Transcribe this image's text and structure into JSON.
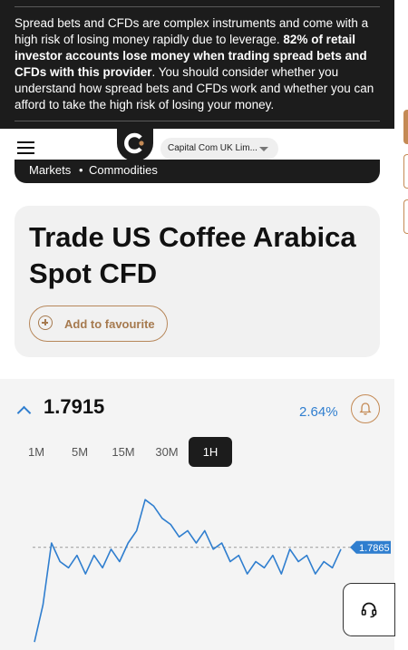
{
  "risk_warning": {
    "part1": "Spread bets and CFDs are complex instruments and come with a high risk of losing money rapidly due to leverage. ",
    "bold": "82% of retail investor accounts lose money when trading spread bets and CFDs with this provider",
    "part2": ". You should consider whether you understand how spread bets and CFDs work and whether you can afford to take the high risk of losing your money."
  },
  "header": {
    "entity_selector": "Capital Com UK Lim..."
  },
  "breadcrumb": {
    "items": [
      "Markets",
      "Commodities"
    ],
    "separator": "•"
  },
  "instrument": {
    "title": "Trade US Coffee Arabica Spot CFD",
    "favourite_label": "Add to favourite"
  },
  "quote": {
    "price": "1.7915",
    "change": "2.64%",
    "direction": "up",
    "timeframes": [
      "1M",
      "5M",
      "15M",
      "30M",
      "1H"
    ],
    "active_timeframe": "1H"
  },
  "chart_data": {
    "type": "line",
    "title": "",
    "xlabel": "",
    "ylabel": "",
    "current_value_label": "1.7865",
    "reference_line": 1.7865,
    "ylim": [
      1.705,
      1.8325
    ],
    "series": [
      {
        "values": [
          1.71,
          1.74,
          1.79,
          1.775,
          1.77,
          1.78,
          1.765,
          1.78,
          1.77,
          1.785,
          1.775,
          1.79,
          1.8,
          1.825,
          1.82,
          1.81,
          1.805,
          1.795,
          1.8,
          1.79,
          1.8,
          1.785,
          1.79,
          1.775,
          1.78,
          1.765,
          1.775,
          1.77,
          1.78,
          1.765,
          1.785,
          1.775,
          1.78,
          1.765,
          1.775,
          1.77,
          1.785
        ]
      }
    ]
  },
  "colors": {
    "accent": "#2f7ecf",
    "brand_gold": "#c48a55",
    "dark": "#1c1c1c"
  },
  "icons": {
    "menu": "hamburger-icon",
    "bell": "bell-icon",
    "support": "headset-icon",
    "favourite": "plus-circle-icon"
  }
}
